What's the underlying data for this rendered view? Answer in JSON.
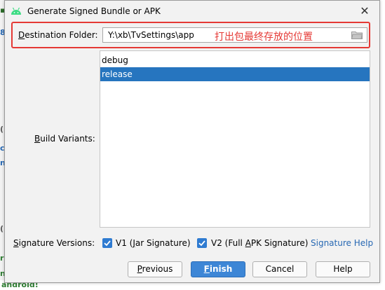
{
  "background": {
    "bottom_text": "android!"
  },
  "dialog": {
    "title": "Generate Signed Bundle or APK",
    "icon": "android-icon",
    "close_icon": "close-icon"
  },
  "destination": {
    "label_prefix": "D",
    "label_rest": "estination Folder:",
    "value": "Y:\\xb\\TvSettings\\app",
    "annotation": "打出包最终存放的位置",
    "browse_icon": "folder-icon",
    "highlight_color": "#e53935"
  },
  "variants": {
    "label_prefix": "B",
    "label_rest": "uild Variants:",
    "items": [
      "debug",
      "release"
    ],
    "selected": "release",
    "selection_color": "#2675bf"
  },
  "signature": {
    "label_prefix": "S",
    "label_rest": "ignature Versions:",
    "v1_label_pre": "V1 (",
    "v1_label_mnemonic": "J",
    "v1_label_post": "ar Signature)",
    "v1_checked": true,
    "v2_label_pre": "V2 (Full ",
    "v2_label_mnemonic": "A",
    "v2_label_post": "PK Signature)",
    "v2_checked": true,
    "help_link": "Signature Help"
  },
  "buttons": {
    "previous_prefix": "P",
    "previous_rest": "revious",
    "finish_prefix": "F",
    "finish_rest": "inish",
    "cancel": "Cancel",
    "help": "Help"
  }
}
